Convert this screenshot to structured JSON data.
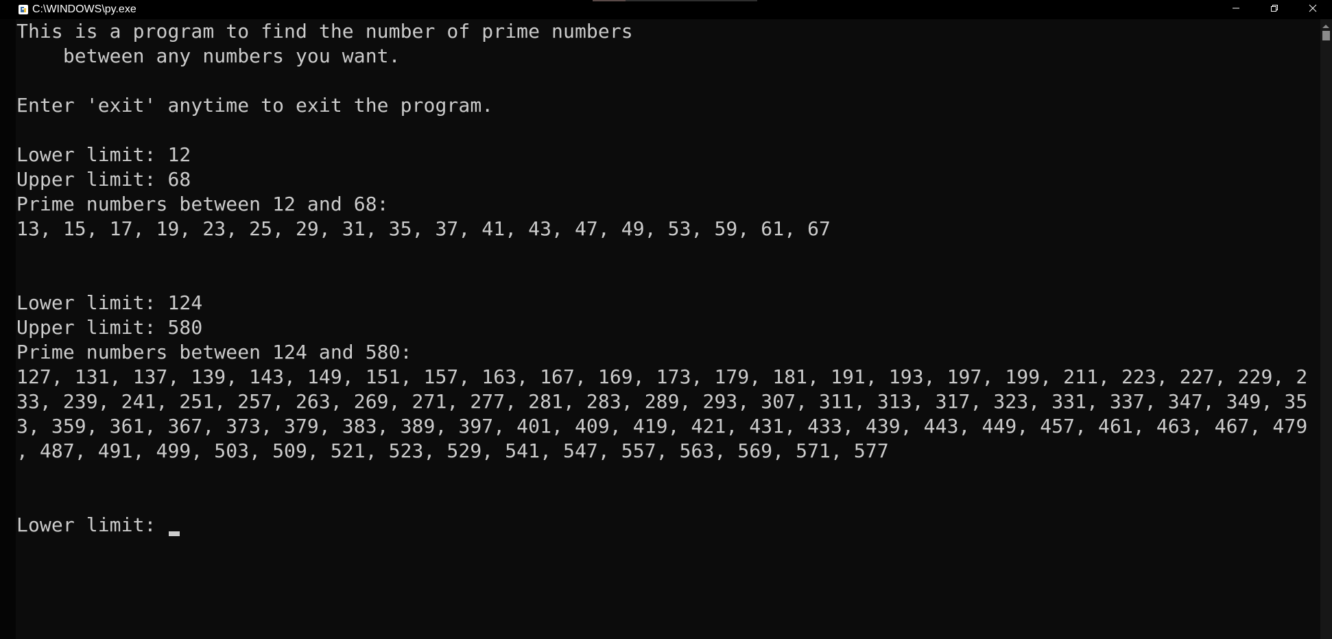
{
  "window": {
    "title": "C:\\WINDOWS\\py.exe"
  },
  "colors": {
    "background": "#0c0c0c",
    "foreground": "#cccccc",
    "titlebar": "#000000"
  },
  "console": {
    "lines": [
      "This is a program to find the number of prime numbers",
      "    between any numbers you want.",
      "",
      "Enter 'exit' anytime to exit the program.",
      "",
      "Lower limit: 12",
      "Upper limit: 68",
      "Prime numbers between 12 and 68:",
      "13, 15, 17, 19, 23, 25, 29, 31, 35, 37, 41, 43, 47, 49, 53, 59, 61, 67",
      "",
      "",
      "Lower limit: 124",
      "Upper limit: 580",
      "Prime numbers between 124 and 580:",
      "127, 131, 137, 139, 143, 149, 151, 157, 163, 167, 169, 173, 179, 181, 191, 193, 197, 199, 211, 223, 227, 229, 2",
      "33, 239, 241, 251, 257, 263, 269, 271, 277, 281, 283, 289, 293, 307, 311, 313, 317, 323, 331, 337, 347, 349, 35",
      "3, 359, 361, 367, 373, 379, 383, 389, 397, 401, 409, 419, 421, 431, 433, 439, 443, 449, 457, 461, 463, 467, 479",
      ", 487, 491, 499, 503, 509, 521, 523, 529, 541, 547, 557, 563, 569, 571, 577",
      "",
      ""
    ],
    "prompt": "Lower limit: ",
    "input_value": ""
  },
  "icons": {
    "app": "python-launcher-icon",
    "minimize": "minimize-icon",
    "restore": "restore-icon",
    "close": "close-icon"
  }
}
